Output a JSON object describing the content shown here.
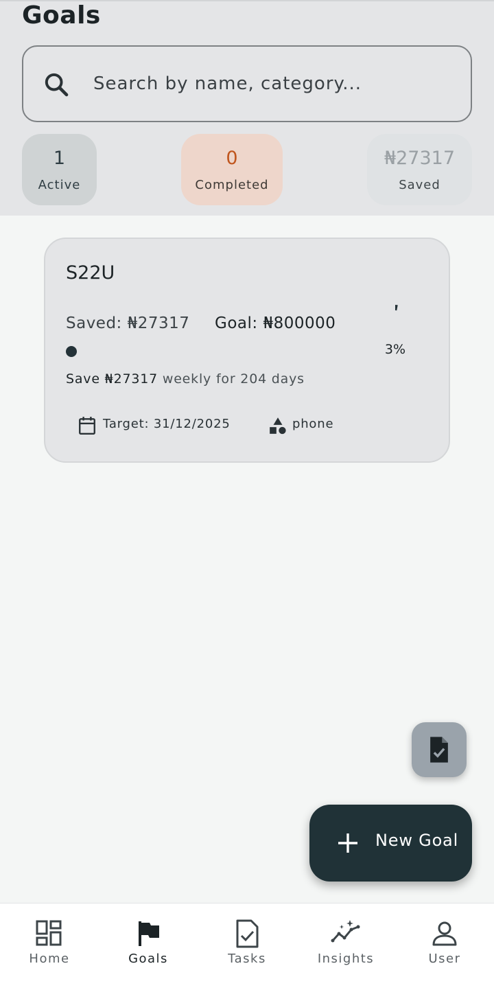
{
  "header": {
    "title": "Goals",
    "search": {
      "placeholder": "Search by name, category...",
      "icon": "search-icon"
    }
  },
  "stats": {
    "active": {
      "value": "1",
      "label": "Active"
    },
    "completed": {
      "value": "0",
      "label": "Completed",
      "color": "#c0561e"
    },
    "saved": {
      "value": "₦27317",
      "label": "Saved"
    }
  },
  "goals": [
    {
      "name": "S22U",
      "saved_text": "Saved: ₦27317",
      "goal_text": "Goal: ₦800000",
      "progress_percent": 3,
      "percent_label": "3%",
      "save_amount": "Save ₦27317",
      "save_schedule": " weekly for 204 days",
      "target": "Target: 31/12/2025",
      "category": "phone"
    }
  ],
  "fab": {
    "new_goal_label": "New Goal",
    "report_icon": "task-document-icon"
  },
  "nav": {
    "items": [
      {
        "label": "Home",
        "icon": "dashboard-icon"
      },
      {
        "label": "Goals",
        "icon": "flag-icon",
        "active": true
      },
      {
        "label": "Tasks",
        "icon": "task-icon"
      },
      {
        "label": "Insights",
        "icon": "insights-icon"
      },
      {
        "label": "User",
        "icon": "user-icon"
      }
    ]
  },
  "colors": {
    "accent": "#203237",
    "header_bg": "#e4e5e7",
    "page_bg": "#f4f6f5"
  }
}
